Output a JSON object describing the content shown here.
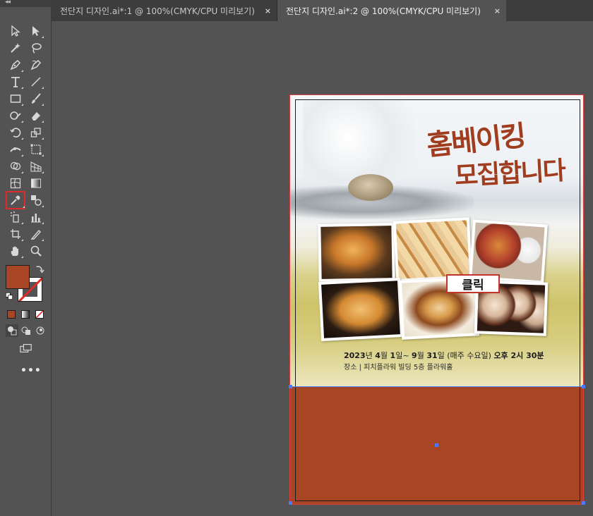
{
  "toolbar": {
    "collapse_label": "◂◂",
    "fill_color": "#a84525",
    "stroke_color": "none",
    "more_tools_label": "•••"
  },
  "tabs": [
    {
      "label": "전단지 디자인.ai*:1 @ 100%(CMYK/CPU 미리보기)",
      "close": "×",
      "active": false
    },
    {
      "label": "전단지 디자인.ai*:2 @ 100%(CMYK/CPU 미리보기)",
      "close": "×",
      "active": true
    }
  ],
  "artboard": {
    "headline_line1": "홈베이킹",
    "headline_line2": "모집합니다",
    "click_button": "클릭",
    "date_line": {
      "year": "2023",
      "y_unit": "년",
      "start_month": "4",
      "m_unit1": "월",
      "start_day": "1",
      "d_unit1": "일",
      "sep": "~",
      "end_month": "9",
      "m_unit2": "월",
      "end_day": "31",
      "d_unit2": "일",
      "closed": "(매주 수요일)",
      "time": "오후 2시 30분"
    },
    "place_line": "장소 |  피치플라워 빌딩 5층 플라워홀"
  },
  "colors": {
    "accent_brown": "#a84525",
    "headline": "#a03d1f",
    "bleed_guide": "#e43c3c",
    "selection": "#4b7bff"
  }
}
